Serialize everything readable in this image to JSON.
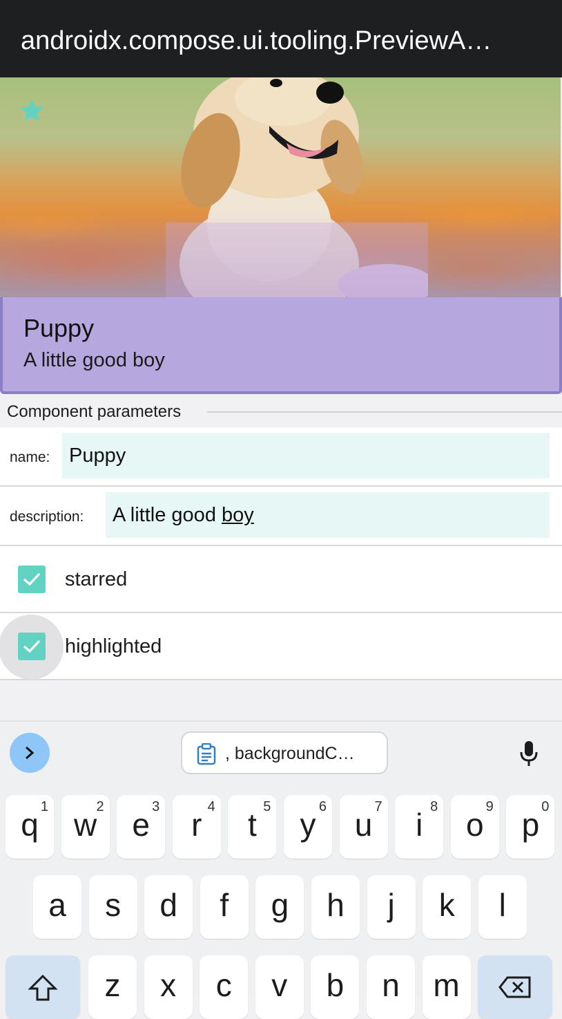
{
  "app_bar": {
    "title": "androidx.compose.ui.tooling.PreviewA…"
  },
  "card": {
    "title": "Puppy",
    "description": "A little good boy",
    "starred_icon": "star-icon",
    "accent": "#62d3c2"
  },
  "params": {
    "header": "Component parameters",
    "name": {
      "label": "name:",
      "value": "Puppy"
    },
    "description": {
      "label": "description:",
      "value_prefix": "A little good ",
      "value_suggestion": "boy"
    },
    "starred": {
      "label": "starred",
      "checked": true
    },
    "highlighted": {
      "label": "highlighted",
      "checked": true
    }
  },
  "keyboard": {
    "clipboard_chip": ", backgroundC…",
    "row1": [
      {
        "ch": "q",
        "hint": "1"
      },
      {
        "ch": "w",
        "hint": "2"
      },
      {
        "ch": "e",
        "hint": "3"
      },
      {
        "ch": "r",
        "hint": "4"
      },
      {
        "ch": "t",
        "hint": "5"
      },
      {
        "ch": "y",
        "hint": "6"
      },
      {
        "ch": "u",
        "hint": "7"
      },
      {
        "ch": "i",
        "hint": "8"
      },
      {
        "ch": "o",
        "hint": "9"
      },
      {
        "ch": "p",
        "hint": "0"
      }
    ],
    "row2": [
      "a",
      "s",
      "d",
      "f",
      "g",
      "h",
      "j",
      "k",
      "l"
    ],
    "row3": [
      "z",
      "x",
      "c",
      "v",
      "b",
      "n",
      "m"
    ]
  }
}
